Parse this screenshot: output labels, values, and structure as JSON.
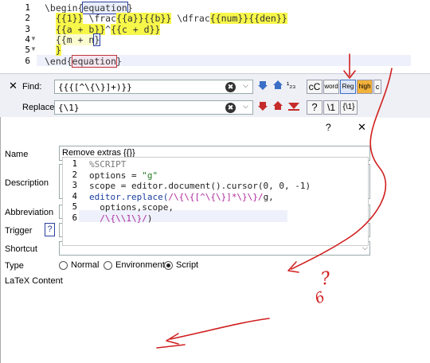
{
  "editor": {
    "line_numbers": [
      "1",
      "2",
      "3",
      "4",
      "5",
      "6"
    ],
    "lines": [
      {
        "parts": [
          {
            "t": "\\begin{",
            "c": ""
          },
          {
            "t": "equation",
            "c": "boxed"
          },
          {
            "t": "}",
            "c": ""
          }
        ]
      },
      {
        "parts": [
          {
            "t": "  ",
            "c": ""
          },
          {
            "t": "{{1}}",
            "c": "hl-yellow"
          },
          {
            "t": " \\frac",
            "c": ""
          },
          {
            "t": "{{a}}",
            "c": "hl-yellow"
          },
          {
            "t": "{{b}}",
            "c": "hl-yellow"
          },
          {
            "t": " \\dfrac",
            "c": ""
          },
          {
            "t": "{{num}}",
            "c": "hl-yellow"
          },
          {
            "t": "{{den}}",
            "c": "hl-yellow"
          }
        ]
      },
      {
        "parts": [
          {
            "t": "  ",
            "c": ""
          },
          {
            "t": "{{a + b}}",
            "c": "hl-yellow"
          },
          {
            "t": "^",
            "c": ""
          },
          {
            "t": "{{c + d}}",
            "c": "hl-yellow"
          }
        ]
      },
      {
        "parts": [
          {
            "t": "  ",
            "c": ""
          },
          {
            "t": "{{m + n",
            "c": "hl-light"
          },
          {
            "t": "}",
            "c": "boxed"
          }
        ]
      },
      {
        "parts": [
          {
            "t": "  ",
            "c": ""
          },
          {
            "t": "}",
            "c": "hl-yellow"
          }
        ]
      },
      {
        "parts": [
          {
            "t": "\\end{",
            "c": ""
          },
          {
            "t": "equation",
            "c": "boxed-red"
          },
          {
            "t": "}",
            "c": ""
          }
        ]
      }
    ]
  },
  "findbar": {
    "close_glyph": "✕",
    "find_label": "Find:",
    "find_value": "{{{[^\\{\\}]+)}}",
    "replace_label": "Replace:",
    "replace_value": "{\\1}",
    "clear_glyph": "✖",
    "dropdown_glyph": "⌵",
    "count_label": "¹₂₃",
    "case_label": "cC",
    "word_label": "word",
    "regex_label": "Reg",
    "highlight_label": "high",
    "cursor_label": "c",
    "question_label": "?",
    "backref_label": "\\1",
    "group_label": "{\\1}",
    "accent": "#3b6fc7",
    "danger": "#c62b2b"
  },
  "dialog": {
    "help_label": "?",
    "close_label": "✕",
    "name_label": "Name",
    "name_value": "Remove extras {{}}",
    "description_label": "Description",
    "abbreviation_label": "Abbreviation",
    "trigger_label": "Trigger",
    "trigger_help": "?",
    "shortcut_label": "Shortcut",
    "type_label": "Type",
    "type_options": [
      "Normal",
      "Environment",
      "Script"
    ],
    "type_selected": "Script",
    "latex_content_label": "LaTeX Content",
    "script_line_numbers": [
      "1",
      "2",
      "3",
      "4",
      "5",
      "6"
    ],
    "script_lines": [
      {
        "parts": [
          {
            "t": "%SCRIPT",
            "c": "c-comment"
          }
        ]
      },
      {
        "parts": [
          {
            "t": "options = ",
            "c": ""
          },
          {
            "t": "\"g\"",
            "c": "c-str"
          }
        ]
      },
      {
        "parts": [
          {
            "t": "scope = editor.document().cursor(0, 0, -1)",
            "c": ""
          }
        ]
      },
      {
        "parts": [
          {
            "t": "editor.replace(",
            "c": "c-key"
          },
          {
            "t": "/\\{\\{[^\\{\\}]*\\}\\}/",
            "c": "c-regex"
          },
          {
            "t": "g,",
            "c": ""
          }
        ]
      },
      {
        "parts": [
          {
            "t": "  options,scope,",
            "c": ""
          }
        ]
      },
      {
        "parts": [
          {
            "t": "  ",
            "c": ""
          },
          {
            "t": "/\\{\\\\1\\}/",
            "c": "c-regex"
          },
          {
            "t": ")",
            "c": ""
          }
        ]
      }
    ]
  },
  "annotations": {
    "handwritten": [
      "?",
      "6"
    ],
    "pen_color": "#d11f1f"
  }
}
